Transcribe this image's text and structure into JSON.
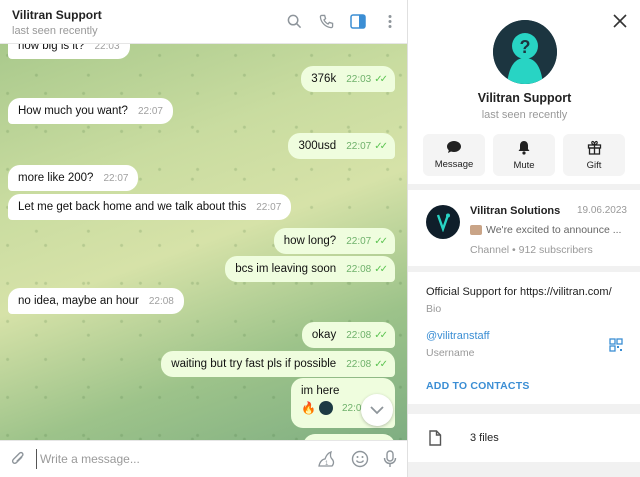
{
  "chat": {
    "title": "Vilitran Support",
    "status": "last seen recently",
    "messages": [
      {
        "dir": "in",
        "text": "how big is it?",
        "time": "22:03"
      },
      {
        "dir": "out",
        "text": "376k",
        "time": "22:03"
      },
      {
        "dir": "in",
        "text": "How much you want?",
        "time": "22:07"
      },
      {
        "dir": "out",
        "text": "300usd",
        "time": "22:07"
      },
      {
        "dir": "in",
        "text": "more like 200?",
        "time": "22:07"
      },
      {
        "dir": "in",
        "text": "Let me get back home and we talk about this",
        "time": "22:07"
      },
      {
        "dir": "out",
        "text": "how long?",
        "time": "22:07"
      },
      {
        "dir": "out",
        "text": "bcs im leaving soon",
        "time": "22:08"
      },
      {
        "dir": "in",
        "text": "no idea, maybe an hour",
        "time": "22:08"
      },
      {
        "dir": "out",
        "text": "okay",
        "time": "22:08"
      },
      {
        "dir": "out",
        "text": "waiting but try fast pls if possible",
        "time": "22:08"
      },
      {
        "dir": "out",
        "text": "im here",
        "time": "22:0"
      }
    ],
    "composer": {
      "placeholder": "Write a message..."
    }
  },
  "profile": {
    "name": "Vilitran Support",
    "status": "last seen recently",
    "actions": [
      {
        "label": "Message",
        "icon": "chat-bubble-icon"
      },
      {
        "label": "Mute",
        "icon": "bell-icon"
      },
      {
        "label": "Gift",
        "icon": "gift-icon"
      }
    ],
    "channel": {
      "name": "Vilitran Solutions",
      "date": "19.06.2023",
      "preview": "We're excited to announce ...",
      "meta": "Channel • 912 subscribers"
    },
    "bio": {
      "text": "Official Support for https://vilitran.com/",
      "label": "Bio"
    },
    "username": {
      "value": "@vilitranstaff",
      "label": "Username"
    },
    "add_contacts": "ADD TO CONTACTS",
    "files": "3 files"
  },
  "colors": {
    "accent": "#3b8ed4",
    "outgoing": "#effdde",
    "check": "#5dc452"
  }
}
